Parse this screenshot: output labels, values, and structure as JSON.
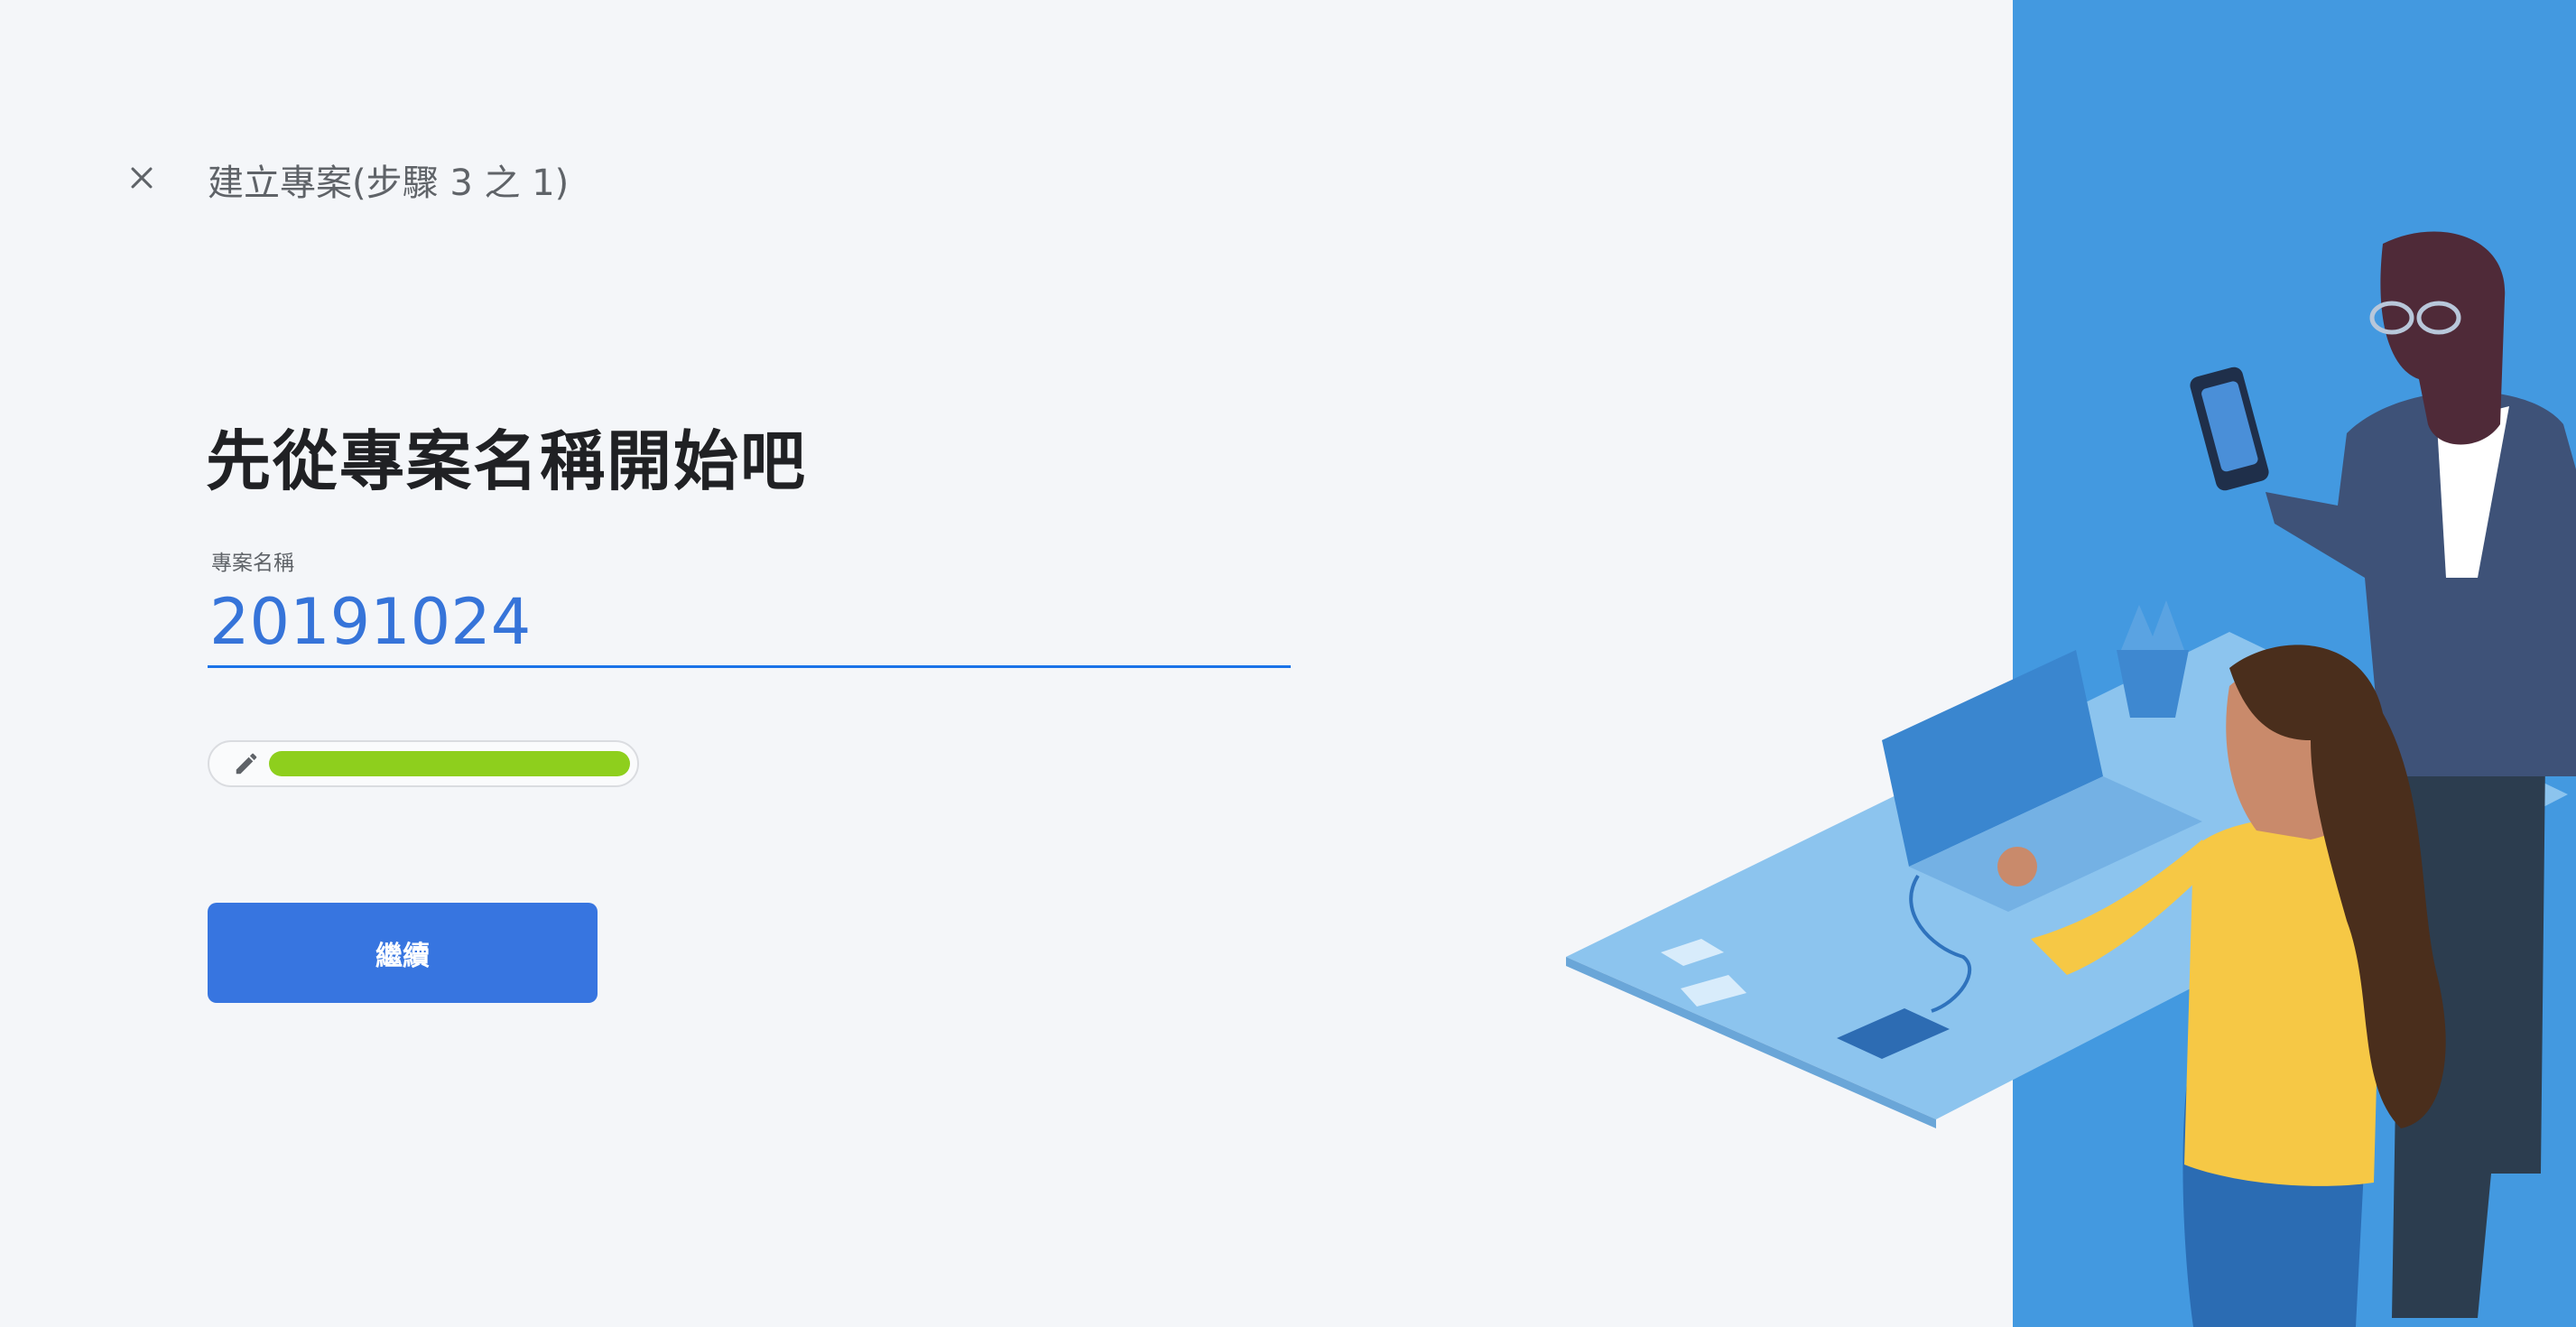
{
  "header": {
    "step_title": "建立專案(步驟 3 之 1)"
  },
  "main": {
    "headline": "先從專案名稱開始吧",
    "project_name": {
      "label": "專案名稱",
      "value": "20191024"
    },
    "project_id_chip": {
      "id_text": ""
    },
    "continue_label": "繼續"
  },
  "icons": {
    "close": "close-icon",
    "edit": "pencil-icon"
  },
  "colors": {
    "accent": "#3775e0",
    "input_text": "#3674d9",
    "input_underline": "#1a73e8",
    "illustration_bg": "#4399e0",
    "highlight": "#8ecf1d"
  }
}
